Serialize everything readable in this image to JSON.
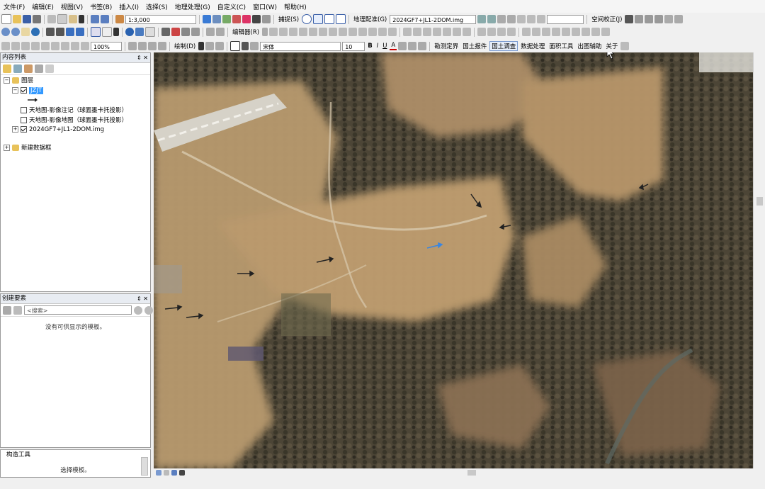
{
  "menu": {
    "items": [
      "文件(F)",
      "编辑(E)",
      "视图(V)",
      "书签(B)",
      "插入(I)",
      "选择(S)",
      "地理处理(G)",
      "自定义(C)",
      "窗口(W)",
      "帮助(H)"
    ]
  },
  "toolbar": {
    "scale_value": "1:3,000",
    "snapping_label": "捕捉(S)",
    "georef_label": "地理配准(G)",
    "georef_layer": "2024GF7+JL1-2DOM.img",
    "spatial_adjust_label": "空间校正(J)",
    "editor_label": "编辑器(R)",
    "zoom_value": "100%",
    "draw_label": "绘制(D)",
    "font_name": "宋体",
    "font_size": "10",
    "bold": "B",
    "italic": "I",
    "underline": "U",
    "font_color_glyph": "A",
    "plugin_menus": [
      "勘测定界",
      "国土报件",
      "国土调查",
      "数据处理",
      "面积工具",
      "出图辅助",
      "关于"
    ]
  },
  "toc": {
    "title": "内容列表",
    "root_label": "图层",
    "layers": [
      {
        "label": "JZJT",
        "checked": true,
        "selected": true
      },
      {
        "label": "天地图-影像注记（球面墨卡托投影）",
        "checked": false
      },
      {
        "label": "天地图-影像地图（球面墨卡托投影）",
        "checked": false
      },
      {
        "label": "2024GF7+JL1-2DOM.img",
        "checked": true
      }
    ],
    "second_group": "新建数据框"
  },
  "create_features": {
    "title": "创建要素",
    "search_placeholder": "<搜索>",
    "empty_message": "没有可供显示的模板。"
  },
  "construct_tools": {
    "title": "构造工具",
    "message": "选择模板。"
  },
  "colors": {
    "panel_title_bg": "#e8ecf2",
    "selected_layer_bg": "#3399ff"
  }
}
